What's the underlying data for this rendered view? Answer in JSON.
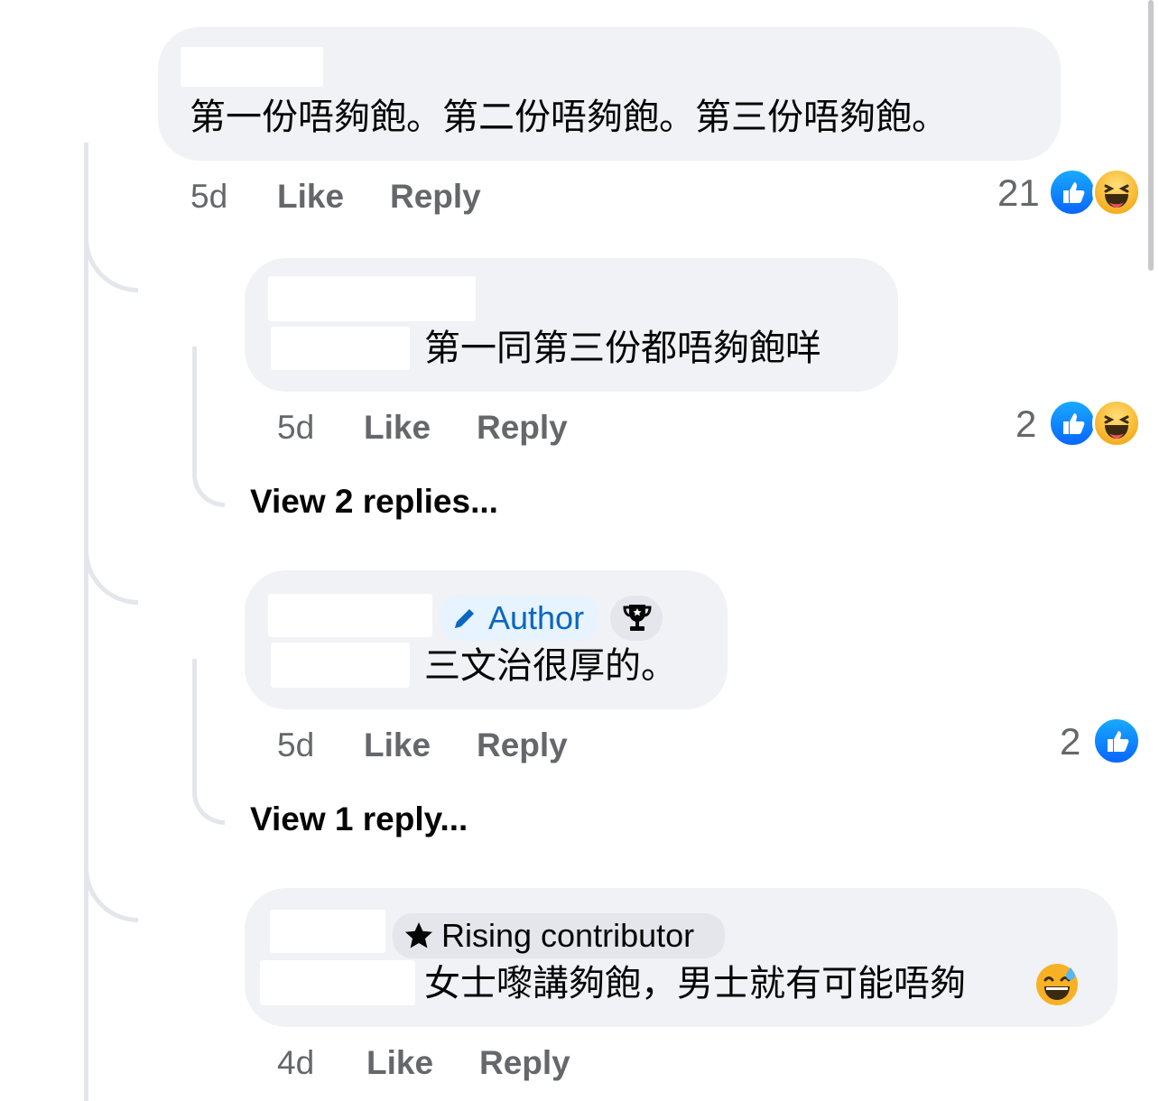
{
  "comments": [
    {
      "text": "第一份唔夠飽。第二份唔夠飽。第三份唔夠飽。",
      "time": "5d",
      "like_label": "Like",
      "reply_label": "Reply",
      "reaction_count": "21",
      "reactions": [
        "like-icon",
        "haha-icon"
      ]
    },
    {
      "text": "第一同第三份都唔夠飽咩",
      "time": "5d",
      "like_label": "Like",
      "reply_label": "Reply",
      "reaction_count": "2",
      "reactions": [
        "like-icon",
        "haha-icon"
      ],
      "view_replies": "View 2 replies..."
    },
    {
      "badge": "Author",
      "text": "三文治很厚的。",
      "time": "5d",
      "like_label": "Like",
      "reply_label": "Reply",
      "reaction_count": "2",
      "reactions": [
        "like-icon"
      ],
      "view_replies": "View 1 reply..."
    },
    {
      "badge": "Rising contributor",
      "text": "女士嚟講夠飽，男士就有可能唔夠",
      "emoji": "😅",
      "time": "4d",
      "like_label": "Like",
      "reply_label": "Reply"
    }
  ],
  "colors": {
    "bubble": "#f0f2f5",
    "meta_text": "#65676b",
    "author_badge": "#0a66c2",
    "like_blue": "#0866ff"
  }
}
